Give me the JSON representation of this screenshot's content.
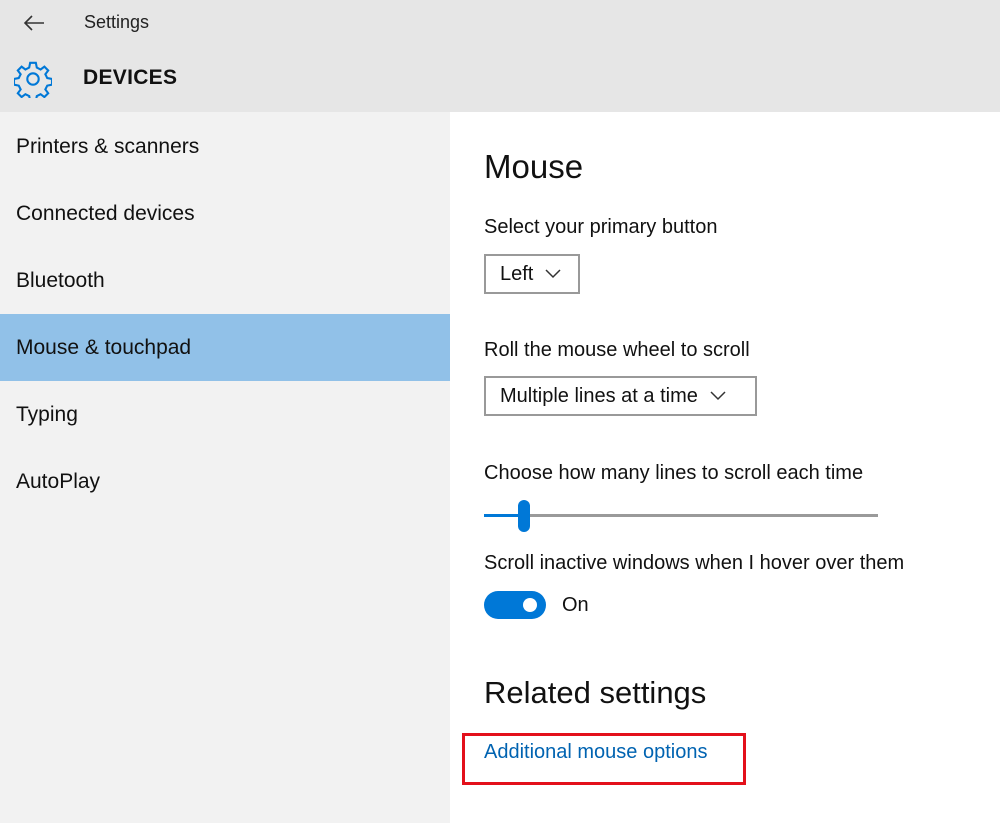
{
  "window": {
    "title": "Settings"
  },
  "header": {
    "section": "DEVICES"
  },
  "sidebar": {
    "items": [
      {
        "label": "Printers & scanners"
      },
      {
        "label": "Connected devices"
      },
      {
        "label": "Bluetooth"
      },
      {
        "label": "Mouse & touchpad"
      },
      {
        "label": "Typing"
      },
      {
        "label": "AutoPlay"
      }
    ],
    "selected": "Mouse & touchpad"
  },
  "main": {
    "heading": "Mouse",
    "primary_button": {
      "label": "Select your primary button",
      "value": "Left"
    },
    "wheel_scroll": {
      "label": "Roll the mouse wheel to scroll",
      "value": "Multiple lines at a time"
    },
    "lines_slider": {
      "label": "Choose how many lines to scroll each time",
      "value_fraction": 0.09
    },
    "inactive_scroll": {
      "label": "Scroll inactive windows when I hover over them",
      "state": "On"
    },
    "related": {
      "heading": "Related settings",
      "link": "Additional mouse options"
    }
  },
  "colors": {
    "accent": "#0078d7",
    "selected_nav": "#91c1e8",
    "link": "#0063b1",
    "highlight_box": "#e3101b"
  },
  "icons": [
    "back-arrow-icon",
    "gear-icon",
    "chevron-down-icon"
  ]
}
